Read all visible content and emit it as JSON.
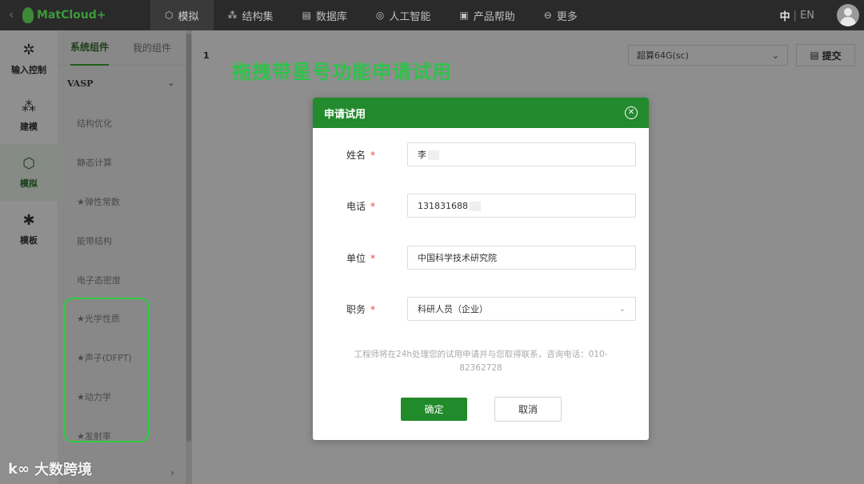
{
  "topbar": {
    "back_glyph": "‹",
    "logo_text": "MatCloud+",
    "nav": [
      {
        "label": "模拟",
        "icon": "cube-icon",
        "glyph": "⬡"
      },
      {
        "label": "结构集",
        "icon": "structure-icon",
        "glyph": "⁂"
      },
      {
        "label": "数据库",
        "icon": "database-icon",
        "glyph": "▤"
      },
      {
        "label": "人工智能",
        "icon": "ai-icon",
        "glyph": "◎"
      },
      {
        "label": "产品帮助",
        "icon": "help-icon",
        "glyph": "▣"
      },
      {
        "label": "更多",
        "icon": "more-icon",
        "glyph": "⊖"
      }
    ],
    "lang_zh": "中",
    "lang_sep": "|",
    "lang_en": "EN"
  },
  "rail": [
    {
      "label": "输入控制",
      "icon": "input-control-icon",
      "glyph": "✲"
    },
    {
      "label": "建模",
      "icon": "modeling-icon",
      "glyph": "⁂"
    },
    {
      "label": "模拟",
      "icon": "simulation-icon",
      "glyph": "⬡"
    },
    {
      "label": "模板",
      "icon": "template-icon",
      "glyph": "✱"
    }
  ],
  "panel": {
    "tabs": [
      "系统组件",
      "我的组件"
    ],
    "group": "VASP",
    "group_chevron": "⌄",
    "components": [
      "结构优化",
      "静态计算",
      "★弹性常数",
      "能带结构",
      "电子态密度",
      "★光学性质",
      "★声子(DFPT)",
      "★动力学",
      "★发射率"
    ],
    "footer_chevron": "›"
  },
  "main": {
    "line_number": "1",
    "instruction": "拖拽带星号功能申请试用",
    "machine_select": "超算64G(sc)",
    "select_chevron": "⌄",
    "submit_label": "提交",
    "submit_glyph": "▤"
  },
  "modal": {
    "title": "申请试用",
    "close_glyph": "✕",
    "required_mark": "*",
    "fields": [
      {
        "label": "姓名",
        "value": "李"
      },
      {
        "label": "电话",
        "value": "131831688"
      },
      {
        "label": "单位",
        "value": "中国科学技术研究院"
      },
      {
        "label": "职务",
        "value": "科研人员（企业）"
      }
    ],
    "select_chevron": "⌄",
    "note": "工程师将在24h处理您的试用申请并与您取得联系，咨询电话：010-82362728",
    "ok_label": "确定",
    "cancel_label": "取消"
  },
  "watermark": {
    "text": "大数跨境",
    "logo_glyph": "k∞"
  }
}
